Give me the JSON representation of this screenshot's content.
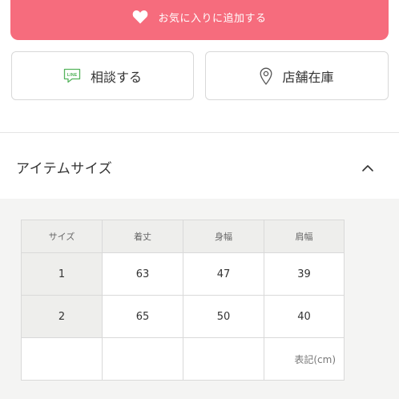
{
  "favorite": {
    "label": "お気に入りに追加する",
    "icon": "heart-icon",
    "color": "#f66c7d"
  },
  "actions": [
    {
      "label": "相談する",
      "icon": "line-chat-icon",
      "icon_text": "LINE"
    },
    {
      "label": "店舗在庫",
      "icon": "location-pin-icon"
    }
  ],
  "section": {
    "title": "アイテムサイズ",
    "toggle_icon": "chevron-up-icon"
  },
  "size_table": {
    "headers": [
      "サイズ",
      "着丈",
      "身幅",
      "肩幅"
    ],
    "rows": [
      [
        "1",
        "63",
        "47",
        "39"
      ],
      [
        "2",
        "65",
        "50",
        "40"
      ]
    ],
    "unit_note": "表記(cm)"
  }
}
